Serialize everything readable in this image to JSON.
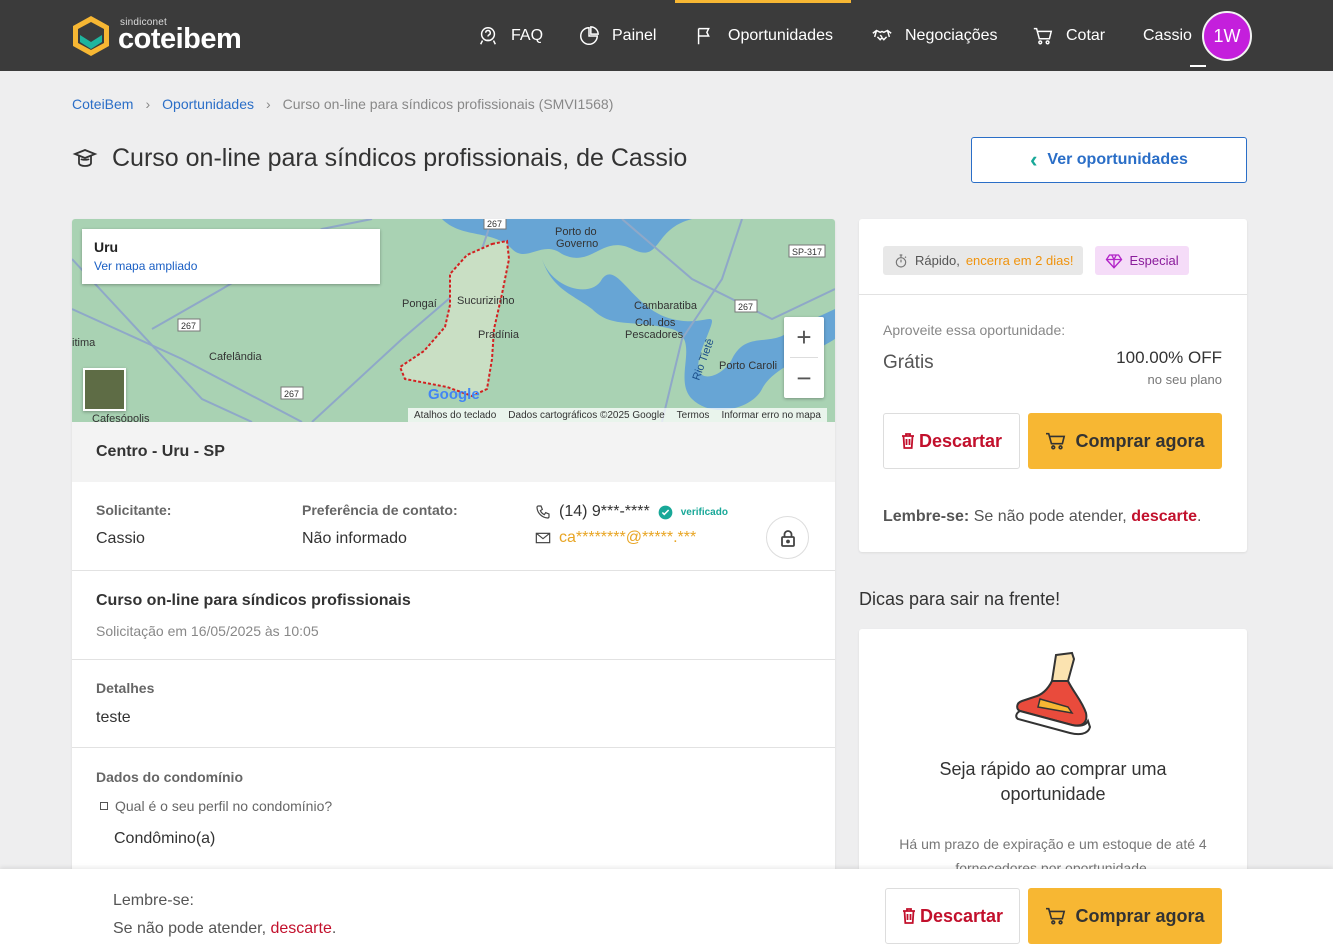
{
  "brand": {
    "small": "sindiconet",
    "name": "coteibem"
  },
  "nav": {
    "items": [
      {
        "label": "FAQ",
        "icon": "faq-icon"
      },
      {
        "label": "Painel",
        "icon": "chart-pie-icon"
      },
      {
        "label": "Oportunidades",
        "icon": "flag-icon",
        "active": true
      },
      {
        "label": "Negociações",
        "icon": "handshake-icon"
      },
      {
        "label": "Cotar",
        "icon": "cart-icon"
      }
    ],
    "user_name": "Cassio",
    "avatar_text": "1W",
    "avatar_color": "#c41fdc",
    "accent_color": "#f7b733"
  },
  "breadcrumb": {
    "items": [
      "CoteiBem",
      "Oportunidades"
    ],
    "current": "Curso on-line para síndicos profissionais (SMVI1568)"
  },
  "page": {
    "title": "Curso on-line para síndicos profissionais, de Cassio",
    "back_button": "Ver oportunidades"
  },
  "map": {
    "place": "Uru",
    "link": "Ver mapa ampliado",
    "labels": [
      "Porto do Governo",
      "Pongaí",
      "Sucurizinho",
      "Pradínia",
      "Cambaratiba",
      "Col. dos Pescadores",
      "Cafelândia",
      "Porto Caroli",
      "Rio Tietê",
      "Cafesópolis",
      "itima"
    ],
    "roads": [
      "267",
      "267",
      "267",
      "267",
      "SP-317"
    ],
    "google": "Google",
    "footer": [
      "Atalhos do teclado",
      "Dados cartográficos ©2025 Google",
      "Termos",
      "Informar erro no mapa"
    ]
  },
  "location": "Centro - Uru - SP",
  "contact": {
    "requester_label": "Solicitante:",
    "requester": "Cassio",
    "preference_label": "Preferência de contato:",
    "preference": "Não informado",
    "phone": "(14) 9***-****",
    "verified": "verificado",
    "email": "ca********@*****.***"
  },
  "request": {
    "title": "Curso on-line para síndicos profissionais",
    "date": "Solicitação em 16/05/2025 às 10:05"
  },
  "details": {
    "label": "Detalhes",
    "value": "teste"
  },
  "condo": {
    "label": "Dados do condomínio",
    "question": "Qual é o seu perfil no condomínio?",
    "answer": "Condômino(a)"
  },
  "offer": {
    "tag_fast_prefix": "Rápido,",
    "tag_fast_highlight": "encerra em 2 dias!",
    "tag_special": "Especial",
    "hint": "Aproveite essa oportunidade:",
    "price": "Grátis",
    "discount": "100.00% OFF",
    "discount_note": "no seu plano",
    "discard": "Descartar",
    "buy": "Comprar agora",
    "reminder_bold": "Lembre-se:",
    "reminder_text": "Se não pode atender,",
    "reminder_link": "descarte",
    "reminder_end": "."
  },
  "tips": {
    "title": "Dicas para sair na frente!",
    "card_title": "Seja rápido ao comprar uma oportunidade",
    "card_text": "Há um prazo de expiração e um estoque de até 4 fornecedores por oportunidade."
  },
  "sticky": {
    "reminder_title": "Lembre-se:",
    "reminder_text": "Se não pode atender,",
    "reminder_link": "descarte",
    "reminder_end": ".",
    "discard": "Descartar",
    "buy": "Comprar agora"
  }
}
